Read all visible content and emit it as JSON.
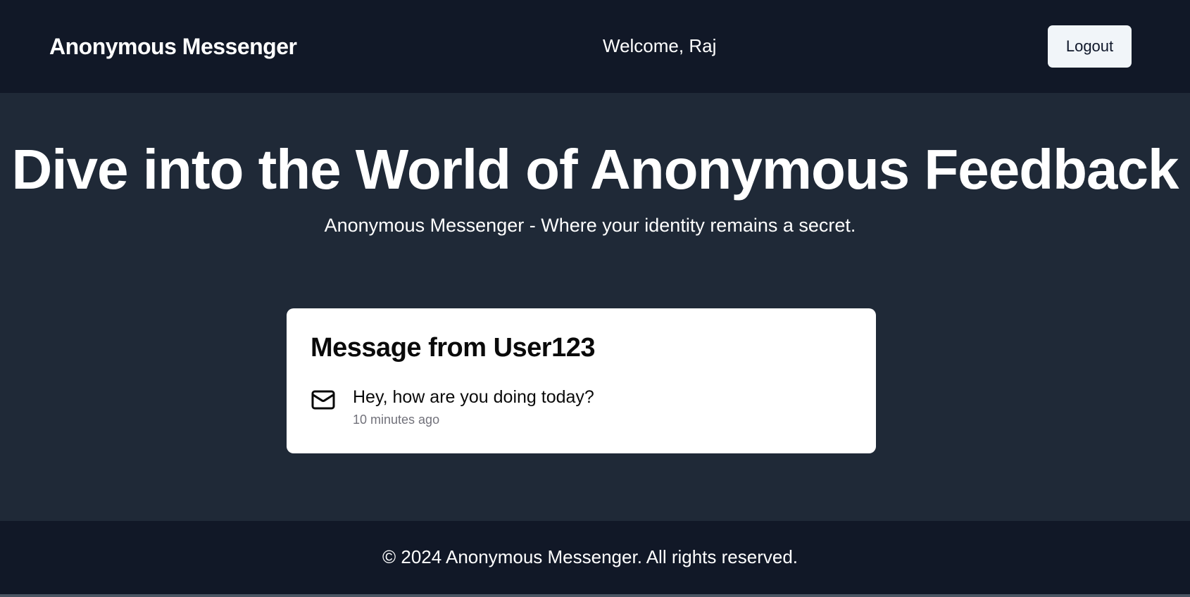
{
  "header": {
    "brand": "Anonymous Messenger",
    "welcome": "Welcome, Raj",
    "logout_label": "Logout"
  },
  "hero": {
    "title": "Dive into the World of Anonymous Feedback",
    "subtitle": "Anonymous Messenger - Where your identity remains a secret."
  },
  "message_card": {
    "title": "Message from User123",
    "icon": "mail-icon",
    "text": "Hey, how are you doing today?",
    "time": "10 minutes ago"
  },
  "footer": {
    "text": "© 2024 Anonymous Messenger. All rights reserved."
  },
  "colors": {
    "nav_background": "#111827",
    "page_background": "#1f2937",
    "card_background": "#ffffff",
    "button_background": "#f1f5f9",
    "muted_text": "#71717a"
  }
}
